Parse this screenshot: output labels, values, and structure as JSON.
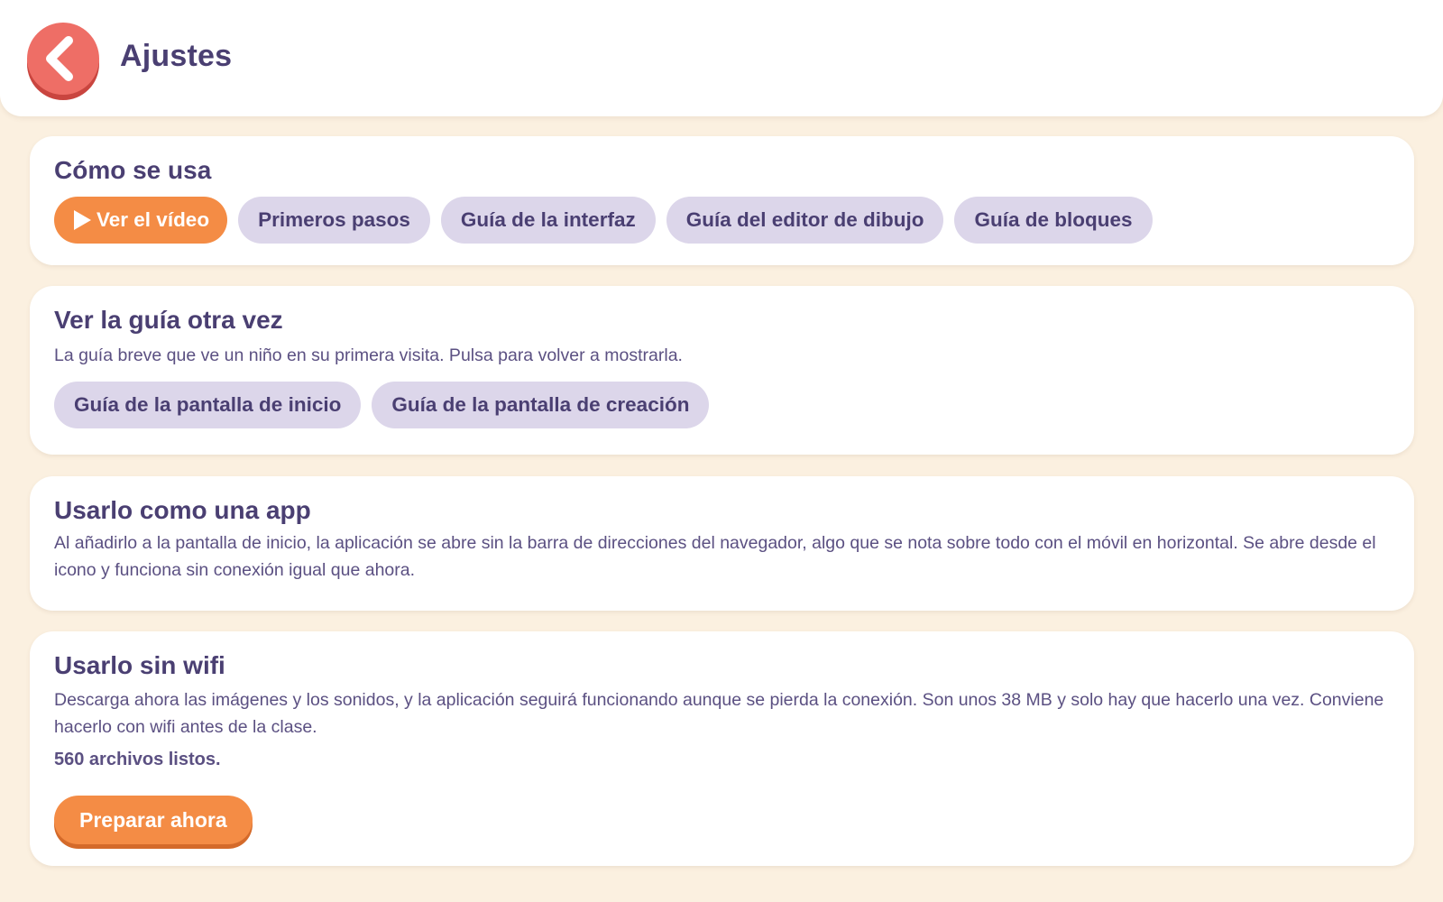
{
  "header": {
    "title": "Ajustes",
    "back_icon": "chevron-left-icon"
  },
  "colors": {
    "background": "#fbf0e0",
    "accent_red": "#ee6e66",
    "accent_orange": "#f48c45",
    "pill_lavender": "#dcd6ea",
    "text_purple": "#4a3f72"
  },
  "how_to_use": {
    "title": "Cómo se usa",
    "buttons": [
      {
        "label": "Ver el vídeo",
        "icon": "play-icon"
      },
      {
        "label": "Primeros pasos"
      },
      {
        "label": "Guía de la interfaz"
      },
      {
        "label": "Guía del editor de dibujo"
      },
      {
        "label": "Guía de bloques"
      }
    ]
  },
  "tour": {
    "title": "Ver la guía otra vez",
    "description": "La guía breve que ve un niño en su primera visita. Pulsa para volver a mostrarla.",
    "buttons": [
      {
        "label": "Guía de la pantalla de inicio"
      },
      {
        "label": "Guía de la pantalla de creación"
      }
    ]
  },
  "install_app": {
    "title": "Usarlo como una app",
    "description": "Al añadirlo a la pantalla de inicio, la aplicación se abre sin la barra de direcciones del navegador, algo que se nota sobre todo con el móvil en horizontal. Se abre desde el icono y funciona sin conexión igual que ahora."
  },
  "offline": {
    "title": "Usarlo sin wifi",
    "description": "Descarga ahora las imágenes y los sonidos, y la aplicación seguirá funcionando aunque se pierda la conexión. Son unos 38 MB y solo hay que hacerlo una vez. Conviene hacerlo con wifi antes de la clase.",
    "status": "560 archivos listos.",
    "button_label": "Preparar ahora"
  }
}
